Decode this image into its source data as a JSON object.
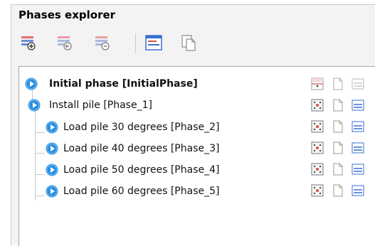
{
  "panel": {
    "title": "Phases explorer"
  },
  "toolbar": {
    "buttons": [
      {
        "name": "insert-phase-button",
        "icon": "insert-phase-icon"
      },
      {
        "name": "add-phase-button",
        "icon": "add-phase-icon"
      },
      {
        "name": "delete-phase-button",
        "icon": "delete-phase-icon"
      },
      {
        "name": "phase-settings-button",
        "icon": "phase-settings-icon"
      },
      {
        "name": "copy-phase-button",
        "icon": "copy-phase-icon"
      }
    ]
  },
  "phases": [
    {
      "label": "Initial phase [InitialPhase]",
      "bold": true,
      "level": 0
    },
    {
      "label": "Install pile [Phase_1]",
      "bold": false,
      "level": 0
    },
    {
      "label": "Load pile 30 degrees [Phase_2]",
      "bold": false,
      "level": 1
    },
    {
      "label": "Load pile 40 degrees [Phase_3]",
      "bold": false,
      "level": 1
    },
    {
      "label": "Load pile 50 degrees [Phase_4]",
      "bold": false,
      "level": 1
    },
    {
      "label": "Load pile 60 degrees [Phase_5]",
      "bold": false,
      "level": 1
    }
  ],
  "colors": {
    "phase_blue": "#2a8fe0",
    "accent_red": "#d05050",
    "accent_blue": "#3a6fd0"
  }
}
